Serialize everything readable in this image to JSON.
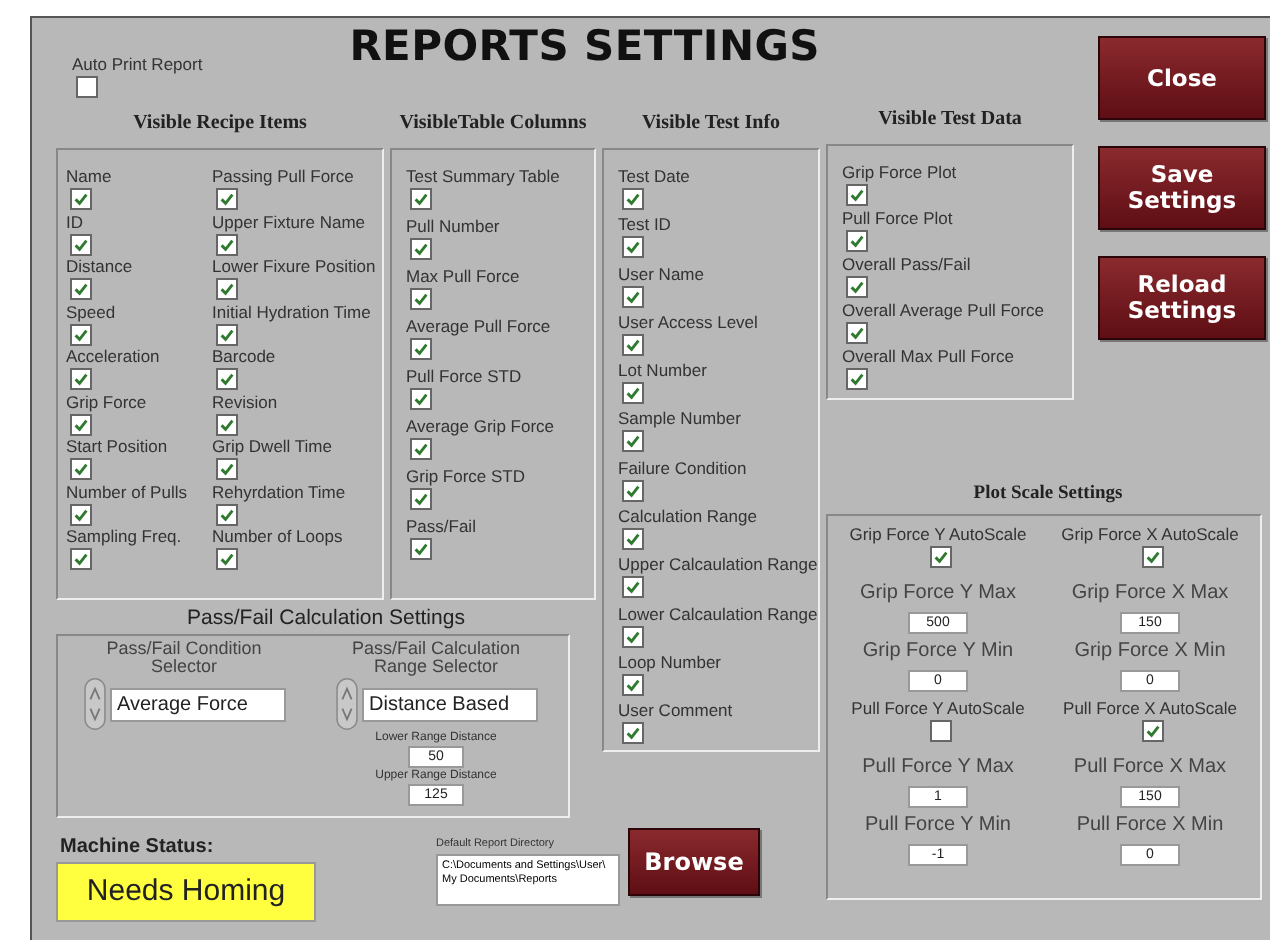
{
  "title": "REPORTS SETTINGS",
  "auto_print": {
    "label": "Auto Print Report",
    "checked": false
  },
  "sections": [
    {
      "kind": "recipe",
      "heading": "Visible Recipe Items",
      "items": [
        {
          "label": "Name",
          "checked": true
        },
        {
          "label": "ID",
          "checked": true
        },
        {
          "label": "Distance",
          "checked": true
        },
        {
          "label": "Speed",
          "checked": true
        },
        {
          "label": "Acceleration",
          "checked": true
        },
        {
          "label": "Grip Force",
          "checked": true
        },
        {
          "label": "Start Position",
          "checked": true
        },
        {
          "label": "Number of Pulls",
          "checked": true
        },
        {
          "label": "Sampling Freq.",
          "checked": true
        },
        {
          "label": "Passing Pull Force",
          "checked": true
        },
        {
          "label": "Upper Fixture Name",
          "checked": true
        },
        {
          "label": "Lower Fixure Position",
          "checked": true
        },
        {
          "label": "Initial Hydration Time",
          "checked": true
        },
        {
          "label": "Barcode",
          "checked": true
        },
        {
          "label": "Revision",
          "checked": true
        },
        {
          "label": "Grip Dwell Time",
          "checked": true
        },
        {
          "label": "Rehyrdation Time",
          "checked": true
        },
        {
          "label": "Number of Loops",
          "checked": true
        }
      ]
    },
    {
      "kind": "table",
      "heading": "VisibleTable Columns",
      "items": [
        {
          "label": "Test Summary Table",
          "checked": true
        },
        {
          "label": "Pull Number",
          "checked": true
        },
        {
          "label": "Max Pull Force",
          "checked": true
        },
        {
          "label": "Average Pull Force",
          "checked": true
        },
        {
          "label": "Pull Force STD",
          "checked": true
        },
        {
          "label": "Average Grip Force",
          "checked": true
        },
        {
          "label": "Grip Force STD",
          "checked": true
        },
        {
          "label": "Pass/Fail",
          "checked": true
        }
      ]
    },
    {
      "kind": "info",
      "heading": "Visible Test Info",
      "items": [
        {
          "label": "Test Date",
          "checked": true
        },
        {
          "label": "Test ID",
          "checked": true
        },
        {
          "label": "User Name",
          "checked": true
        },
        {
          "label": "User Access Level",
          "checked": true
        },
        {
          "label": "Lot Number",
          "checked": true
        },
        {
          "label": "Sample Number",
          "checked": true
        },
        {
          "label": "Failure Condition",
          "checked": true
        },
        {
          "label": "Calculation Range",
          "checked": true
        },
        {
          "label": "Upper Calcaulation Range",
          "checked": true
        },
        {
          "label": "Lower Calcaulation Range",
          "checked": true
        },
        {
          "label": "Loop Number",
          "checked": true
        },
        {
          "label": "User Comment",
          "checked": true
        }
      ]
    },
    {
      "kind": "data",
      "heading": "Visible Test Data",
      "items": [
        {
          "label": "Grip Force Plot",
          "checked": true
        },
        {
          "label": "Pull Force Plot",
          "checked": true
        },
        {
          "label": "Overall Pass/Fail",
          "checked": true
        },
        {
          "label": "Overall Average Pull Force",
          "checked": true
        },
        {
          "label": "Overall Max Pull Force",
          "checked": true
        }
      ]
    }
  ],
  "buttons": [
    "Close",
    "Save Settings",
    "Reload Settings"
  ],
  "pass_fail": {
    "heading": "Pass/Fail Calculation Settings",
    "condition": {
      "label": "Pass/Fail Condition Selector",
      "value": "Average Force"
    },
    "range": {
      "label": "Pass/Fail Calculation Range Selector",
      "value": "Distance Based"
    },
    "lower": {
      "label": "Lower Range Distance",
      "value": "50"
    },
    "upper": {
      "label": "Upper Range Distance",
      "value": "125"
    }
  },
  "plot_scale": {
    "heading": "Plot Scale Settings",
    "items": [
      {
        "kind": "checkbox",
        "label": "Grip Force Y AutoScale",
        "checked": true
      },
      {
        "kind": "checkbox",
        "label": "Grip Force X AutoScale",
        "checked": true
      },
      {
        "kind": "number",
        "label": "Grip Force Y Max",
        "value": "500"
      },
      {
        "kind": "number",
        "label": "Grip Force X Max",
        "value": "150"
      },
      {
        "kind": "number",
        "label": "Grip Force Y Min",
        "value": "0"
      },
      {
        "kind": "number",
        "label": "Grip Force X Min",
        "value": "0"
      },
      {
        "kind": "checkbox",
        "label": "Pull Force Y AutoScale",
        "checked": false
      },
      {
        "kind": "checkbox",
        "label": "Pull Force X AutoScale",
        "checked": true
      },
      {
        "kind": "number",
        "label": "Pull Force Y Max",
        "value": "1"
      },
      {
        "kind": "number",
        "label": "Pull Force X Max",
        "value": "150"
      },
      {
        "kind": "number",
        "label": "Pull Force Y Min",
        "value": "-1"
      },
      {
        "kind": "number",
        "label": "Pull Force X Min",
        "value": "0"
      }
    ]
  },
  "machine_status": {
    "label": "Machine Status:",
    "value": "Needs Homing"
  },
  "report_directory": {
    "label": "Default Report Directory",
    "value": "C:\\Documents and Settings\\User\\ My Documents\\Reports"
  },
  "browse_button": "Browse"
}
